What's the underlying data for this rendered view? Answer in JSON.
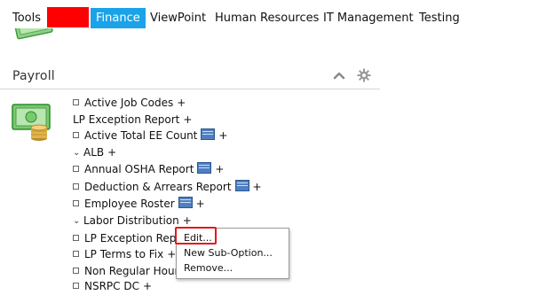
{
  "topnav": {
    "items": [
      "Tools",
      "Finance",
      "ViewPoint",
      "Human Resources",
      "IT Management",
      "Testing"
    ],
    "active": "Finance",
    "redacted_color": "#ff0000",
    "active_color": "#1aa3e8"
  },
  "section": {
    "title": "Payroll",
    "icons": [
      "collapse-up-icon",
      "gear-icon",
      "money-icon"
    ]
  },
  "list": {
    "rows": [
      {
        "label": "Active Job Codes",
        "type": "item",
        "table_icon": false
      },
      {
        "label": "LP Exception Report",
        "type": "plain",
        "table_icon": false
      },
      {
        "label": "Active Total EE Count",
        "type": "item",
        "table_icon": true
      },
      {
        "label": "ALB",
        "type": "folder",
        "table_icon": false
      },
      {
        "label": "Annual OSHA Report",
        "type": "item",
        "table_icon": true
      },
      {
        "label": "Deduction & Arrears Report",
        "type": "item",
        "table_icon": true
      },
      {
        "label": "Employee Roster",
        "type": "item",
        "table_icon": true
      },
      {
        "label": "Labor Distribution",
        "type": "folder",
        "table_icon": false
      },
      {
        "label": "LP Exception Repor",
        "type": "item",
        "table_icon": false
      },
      {
        "label": "LP Terms to Fix",
        "type": "item",
        "table_icon": false
      },
      {
        "label": "Non Regular Hours",
        "type": "item",
        "table_icon": false
      },
      {
        "label": "NSRPC DC",
        "type": "item",
        "table_icon": false
      }
    ],
    "plus": "+"
  },
  "context_menu": {
    "items": [
      "Edit...",
      "New Sub-Option...",
      "Remove..."
    ],
    "highlighted": "Edit...",
    "highlight_color": "#e3171a"
  }
}
